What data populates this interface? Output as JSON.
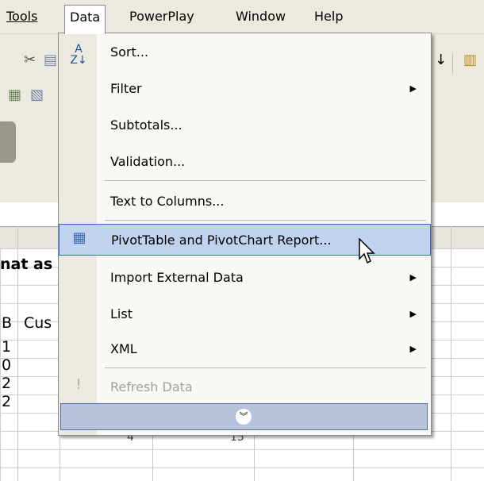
{
  "menubar": {
    "items": [
      "Tools",
      "Data",
      "PowerPlay",
      "Window",
      "Help"
    ]
  },
  "data_menu": {
    "items": [
      {
        "label": "Sort...",
        "icon": "sort-az-icon"
      },
      {
        "label": "Filter",
        "submenu": true
      },
      {
        "label": "Subtotals..."
      },
      {
        "label": "Validation..."
      },
      {
        "label": "Text to Columns..."
      },
      {
        "label": "PivotTable and PivotChart Report...",
        "icon": "pivottable-icon",
        "highlighted": true
      },
      {
        "label": "Import External Data",
        "submenu": true
      },
      {
        "label": "List",
        "submenu": true
      },
      {
        "label": "XML",
        "submenu": true
      },
      {
        "label": "Refresh Data",
        "icon": "refresh-exclamation-icon",
        "disabled": true
      }
    ],
    "expand_icon": "double-chevron-down-icon"
  },
  "sheet": {
    "fragment_text": "nat as",
    "col_b_header": "B",
    "col_c_partial": "Cus",
    "row_values": [
      "1",
      "0",
      "2",
      "2"
    ],
    "row_under_menu_a": "4",
    "row_under_menu_b": "15"
  },
  "colors": {
    "highlight_bg": "#c1d2ee",
    "highlight_border": "#316ac5",
    "menu_bg": "#f9f8f4",
    "gutter_bg": "#eceae0"
  }
}
